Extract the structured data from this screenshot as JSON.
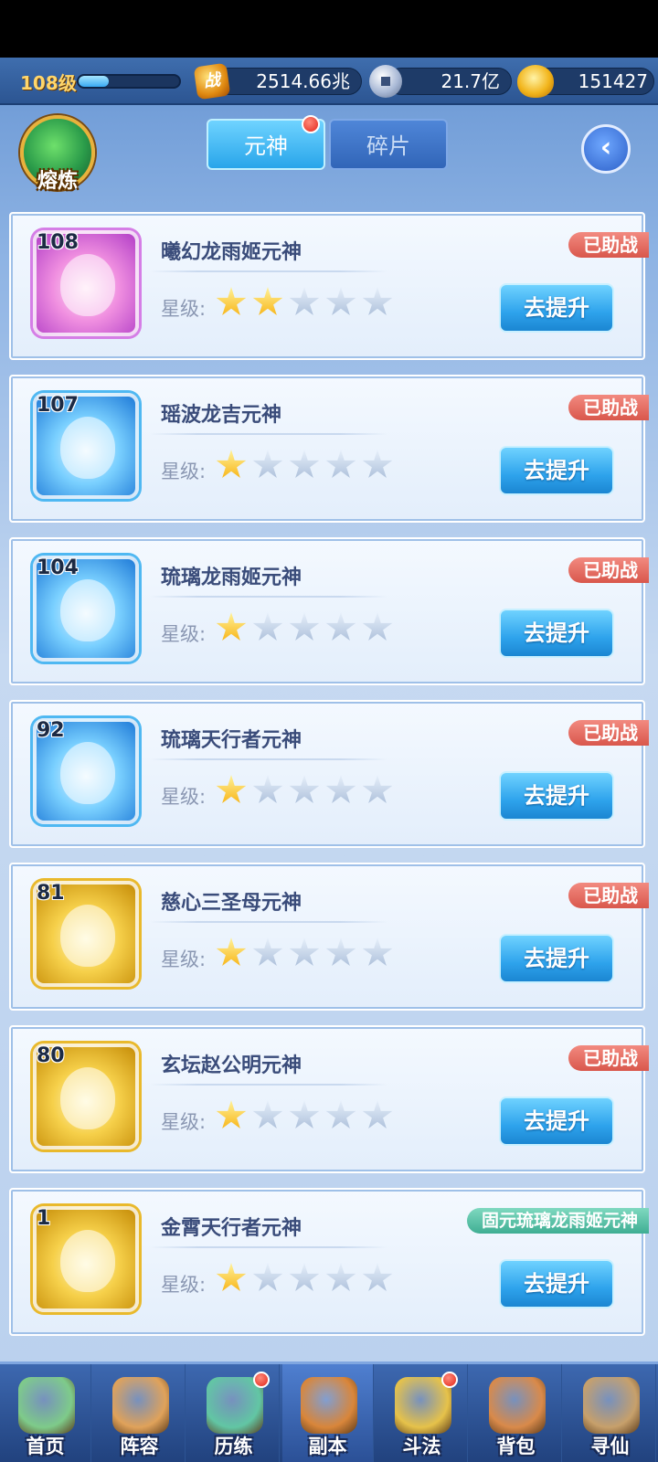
{
  "topbar": {
    "level_text": "108级",
    "xp_progress": 0.3,
    "power_icon_text": "战",
    "power_value": "2514.66兆",
    "coin_value": "21.7亿",
    "gold_value": "151427"
  },
  "header": {
    "furnace_label": "熔炼",
    "tabs": [
      {
        "label": "元神",
        "active": true
      },
      {
        "label": "碎片",
        "active": false
      }
    ],
    "back_glyph": "‹"
  },
  "star_label": "星级:",
  "upgrade_label": "去提升",
  "cards": [
    {
      "level": "108",
      "name": "曦幻龙雨姬元神",
      "stars": 2,
      "tag": "已助战",
      "tag_color": "red",
      "quality": "pink"
    },
    {
      "level": "107",
      "name": "瑶波龙吉元神",
      "stars": 1,
      "tag": "已助战",
      "tag_color": "red",
      "quality": "blue"
    },
    {
      "level": "104",
      "name": "琉璃龙雨姬元神",
      "stars": 1,
      "tag": "已助战",
      "tag_color": "red",
      "quality": "blue"
    },
    {
      "level": "92",
      "name": "琉璃天行者元神",
      "stars": 1,
      "tag": "已助战",
      "tag_color": "red",
      "quality": "blue"
    },
    {
      "level": "81",
      "name": "慈心三圣母元神",
      "stars": 1,
      "tag": "已助战",
      "tag_color": "red",
      "quality": "gold"
    },
    {
      "level": "80",
      "name": "玄坛赵公明元神",
      "stars": 1,
      "tag": "已助战",
      "tag_color": "red",
      "quality": "gold"
    },
    {
      "level": "1",
      "name": "金霄天行者元神",
      "stars": 1,
      "tag": "固元琉璃龙雨姬元神",
      "tag_color": "green",
      "quality": "gold"
    }
  ],
  "bottom_nav": [
    {
      "label": "首页",
      "icon": "home-island-icon",
      "dot": false
    },
    {
      "label": "阵容",
      "icon": "lineup-cards-icon",
      "dot": false
    },
    {
      "label": "历练",
      "icon": "training-gourd-icon",
      "dot": true
    },
    {
      "label": "副本",
      "icon": "dungeon-gate-icon",
      "dot": false,
      "selected": true
    },
    {
      "label": "斗法",
      "icon": "battle-sword-icon",
      "dot": true
    },
    {
      "label": "背包",
      "icon": "backpack-bag-icon",
      "dot": false
    },
    {
      "label": "寻仙",
      "icon": "scroll-search-icon",
      "dot": false
    }
  ],
  "colors": {
    "accent": "#2ea3ec",
    "tag_red": "#d9574c",
    "tag_green": "#3fae93",
    "star_on": "#f7b10f"
  }
}
